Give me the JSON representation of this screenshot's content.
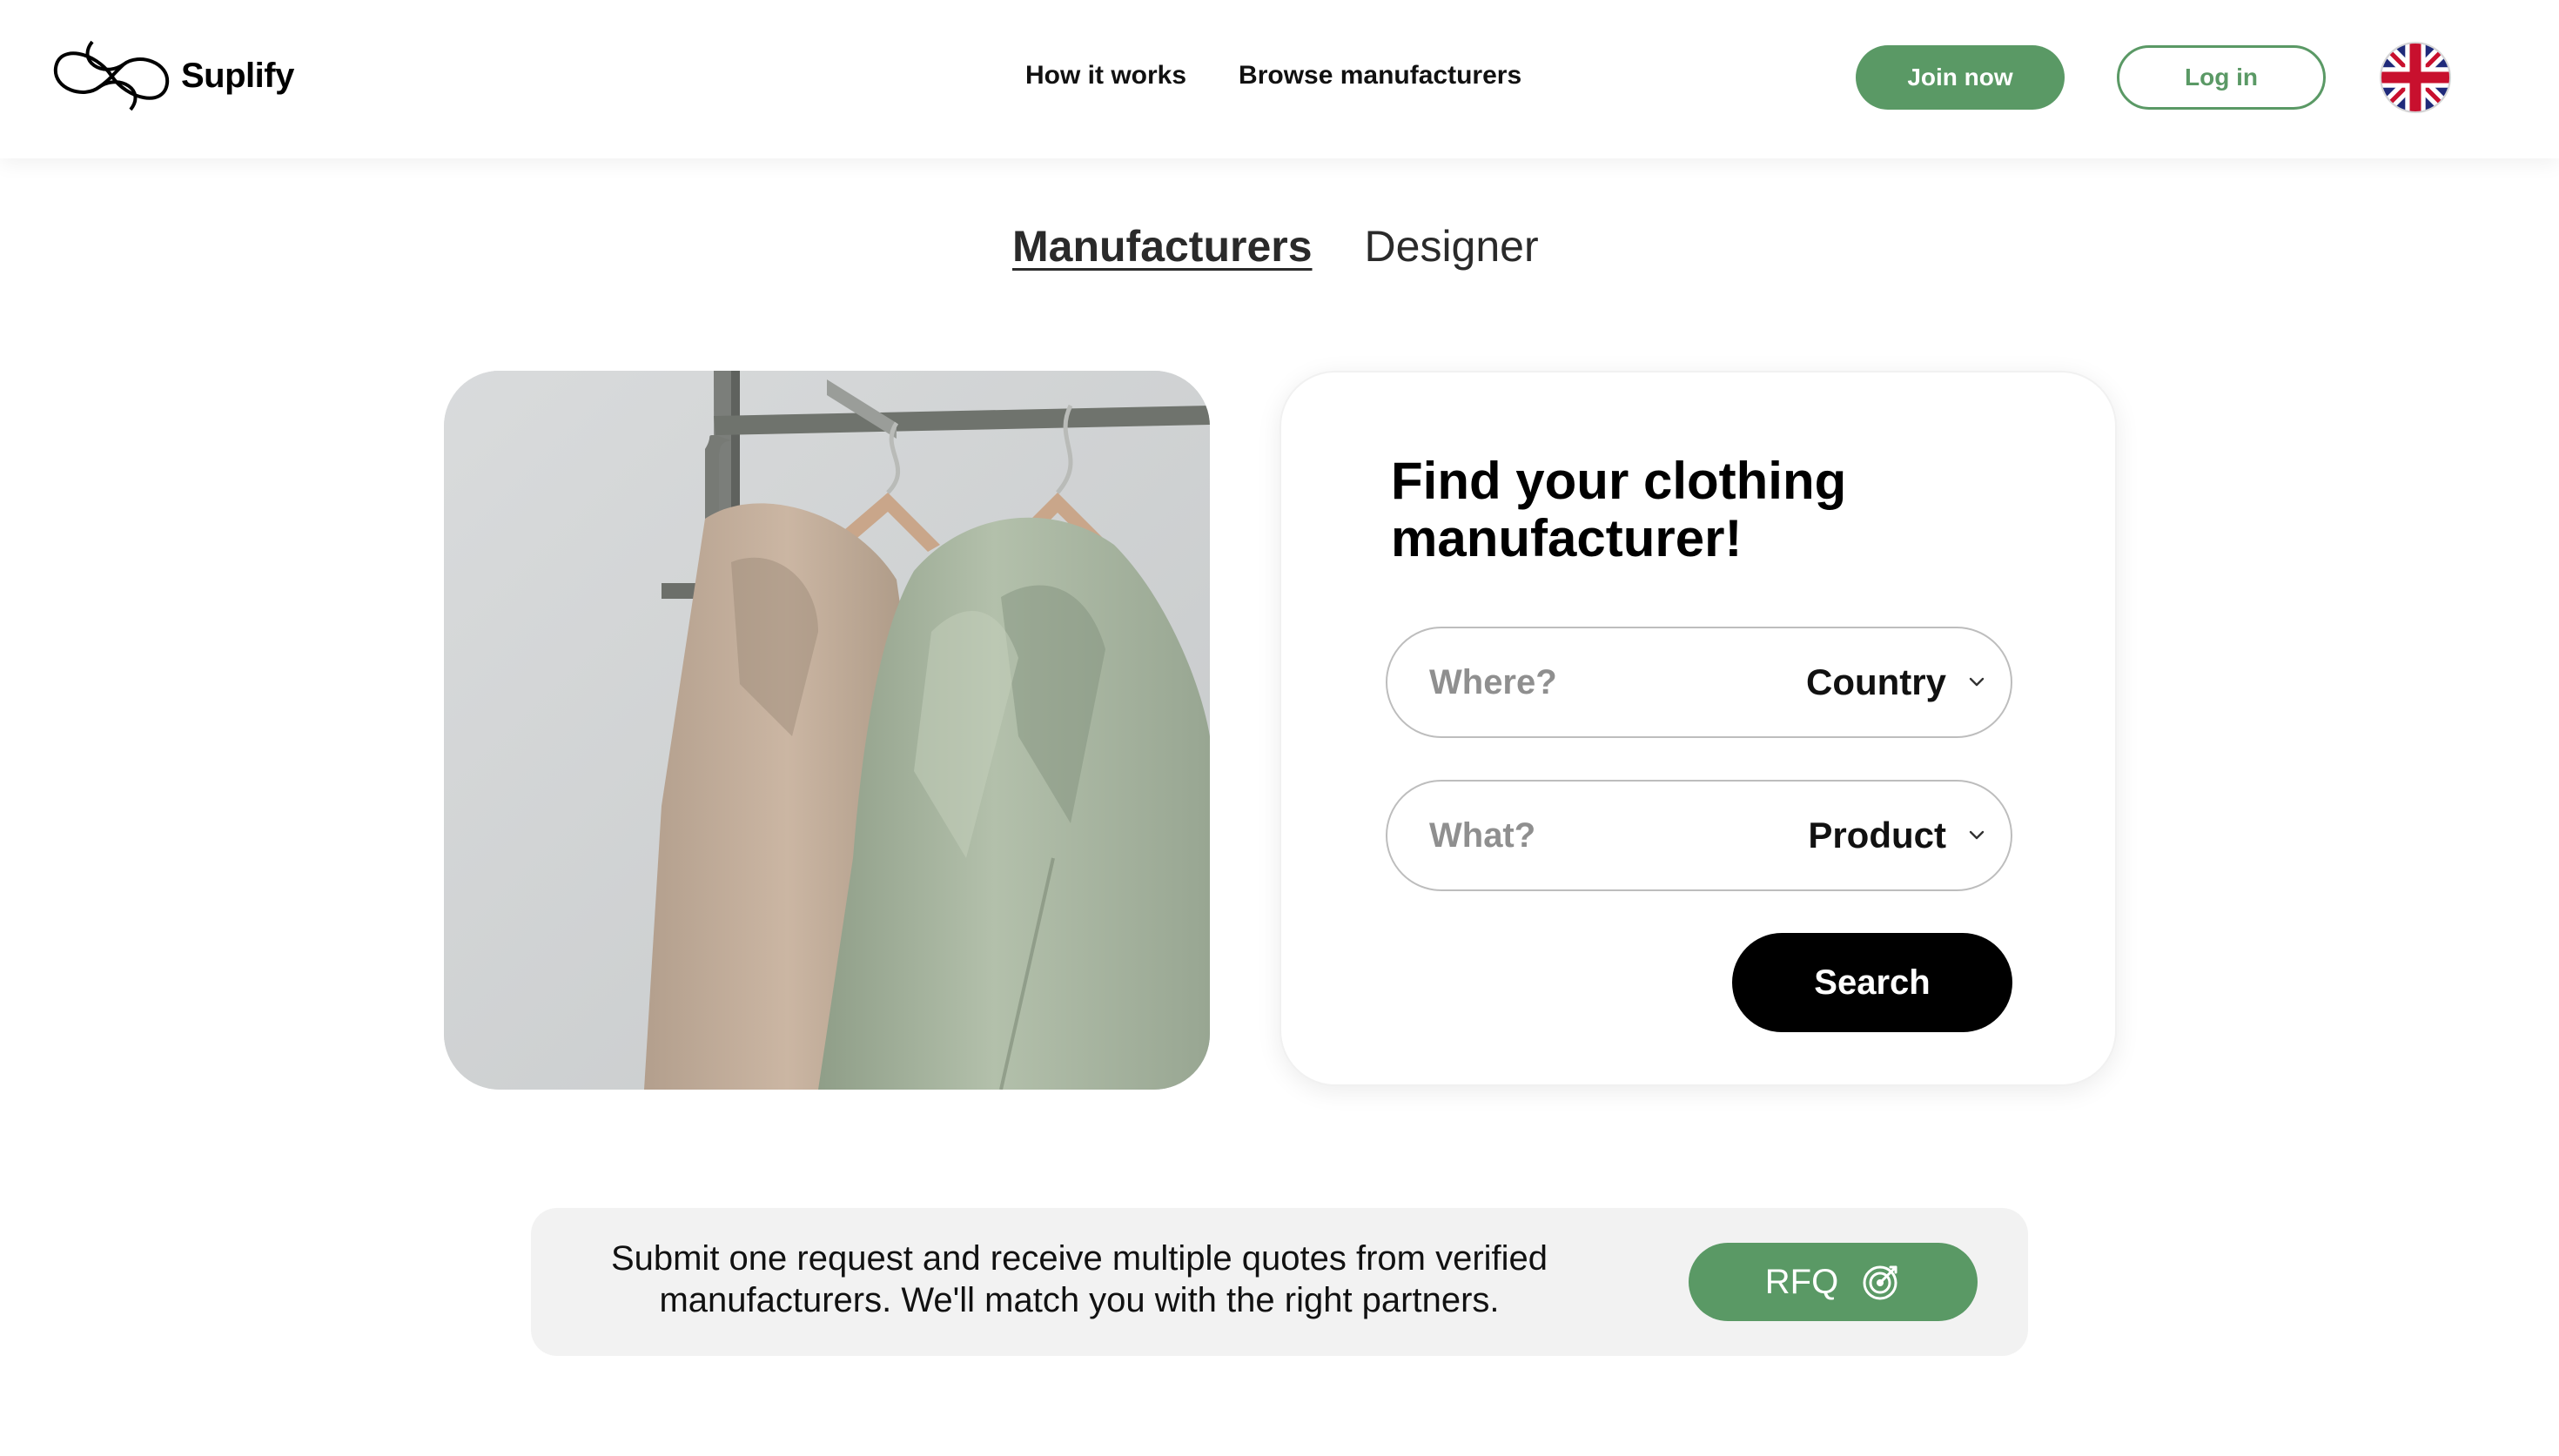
{
  "brand": {
    "name": "Suplify",
    "accent_color": "#5a9965",
    "logo_icon": "infinity-loop-logo-icon"
  },
  "header": {
    "nav": [
      {
        "label": "How it works"
      },
      {
        "label": "Browse manufacturers"
      }
    ],
    "join_label": "Join now",
    "login_label": "Log in",
    "language_icon": "uk-flag-icon"
  },
  "tabs": [
    {
      "label": "Manufacturers",
      "active": true
    },
    {
      "label": "Designer",
      "active": false
    }
  ],
  "hero_image": {
    "icon": "clothing-rack-photo"
  },
  "search_card": {
    "title": "Find your clothing manufacturer!",
    "where": {
      "placeholder": "Where?",
      "select_label": "Country",
      "select_icon": "chevron-down-icon"
    },
    "what": {
      "placeholder": "What?",
      "select_label": "Product",
      "select_icon": "chevron-down-icon"
    },
    "search_label": "Search"
  },
  "rfq": {
    "text": "Submit one request and receive multiple quotes from verified manufacturers. We'll match you with the right partners.",
    "button_label": "RFQ",
    "button_icon": "target-icon"
  }
}
